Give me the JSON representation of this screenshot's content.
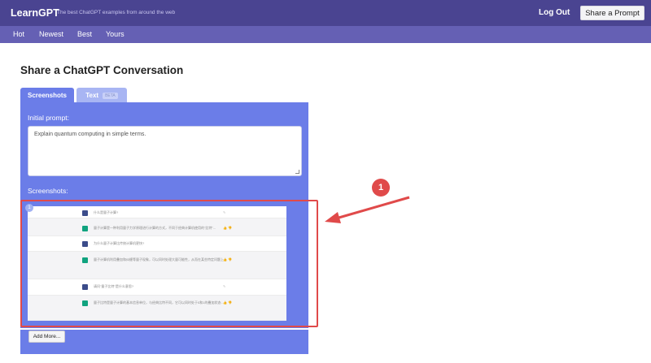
{
  "header": {
    "brand": "LearnGPT",
    "tagline": "The best ChatGPT examples from around the web",
    "logout": "Log Out",
    "share_prompt": "Share a Prompt"
  },
  "nav": [
    "Hot",
    "Newest",
    "Best",
    "Yours"
  ],
  "main": {
    "title": "Share a ChatGPT Conversation",
    "tabs": [
      {
        "label": "Screenshots",
        "active": true
      },
      {
        "label": "Text",
        "badge": "BETA",
        "active": false
      }
    ],
    "initial_prompt_label": "Initial prompt:",
    "initial_prompt_value": "Explain quantum computing in simple terms.",
    "screenshots_label": "Screenshots:",
    "screenshot_index": "1",
    "add_more": "Add More..."
  },
  "screenshot_chat": [
    {
      "role": "user",
      "text": "什么是量子计算?"
    },
    {
      "role": "bot",
      "text": "量子计算是一种利用量子力学原理进行计算的方式，不同于经典计算机使用的\"比特\"..."
    },
    {
      "role": "user",
      "text": "为什么量子计算比传统计算机更快?"
    },
    {
      "role": "bot",
      "text": "量子计算机利用叠加和纠缠等量子现象，可以同时处理大量可能性，从而在某些特定问题上"
    },
    {
      "role": "user",
      "text": "请问\"量子比特\"是什么意思?"
    },
    {
      "role": "bot",
      "text": "量子比特是量子计算的基本信息单位，与经典比特不同，它可以同时处于0和1的叠加状态..."
    }
  ],
  "annotation": {
    "callout_number": "1",
    "color": "#e04a4a"
  },
  "colors": {
    "topbar": "#4a4491",
    "navbar": "#6560b4",
    "panel": "#6b7de8"
  }
}
